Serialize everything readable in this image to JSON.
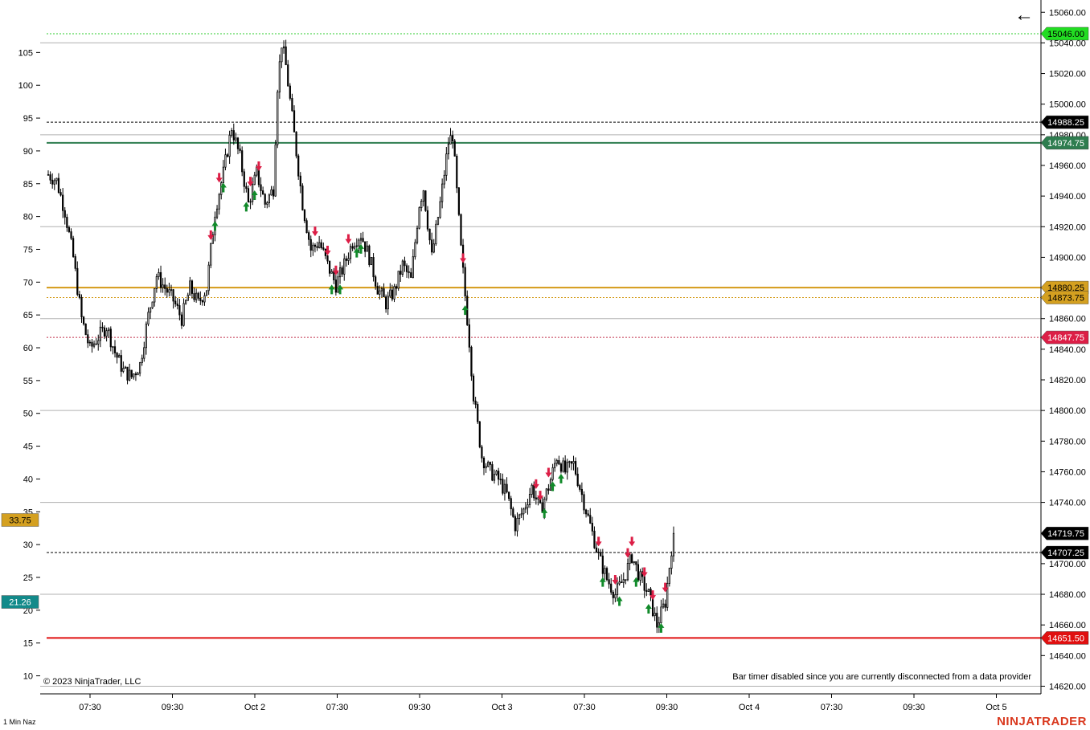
{
  "instrument_label": "1 Min Naz",
  "copyright": "© 2023 NinjaTrader, LLC",
  "bar_timer_message": "Bar timer disabled since you are currently disconnected from a data provider",
  "brand": "NINJATRADER",
  "back_icon": "arrow-left-icon",
  "chart_data": {
    "type": "candlestick",
    "price_axis": {
      "side": "right",
      "ylim": [
        14615,
        15068
      ],
      "ticks": [
        15060,
        15040,
        15020,
        15000,
        14980,
        14960,
        14940,
        14920,
        14900,
        14880,
        14860,
        14840,
        14820,
        14800,
        14780,
        14760,
        14740,
        14720,
        14700,
        14680,
        14660,
        14640,
        14620
      ],
      "tick_labels": [
        "15060.00",
        "15040.00",
        "15020.00",
        "15000.00",
        "14980.00",
        "14960.00",
        "14940.00",
        "14920.00",
        "14900.00",
        "14880.00",
        "14860.00",
        "14840.00",
        "14820.00",
        "14800.00",
        "14780.00",
        "14760.00",
        "14740.00",
        "14720.00",
        "14700.00",
        "14680.00",
        "14660.00",
        "14640.00",
        "14620.00"
      ]
    },
    "indicator_axis": {
      "side": "left",
      "ylim": [
        7.25,
        113
      ],
      "ticks": [
        105,
        100,
        95,
        90,
        85,
        80,
        75,
        70,
        65,
        60,
        55,
        50,
        45,
        40,
        35,
        30,
        25,
        20,
        15,
        10
      ],
      "tick_labels": [
        "105",
        "100",
        "95",
        "90",
        "85",
        "80",
        "75",
        "70",
        "65",
        "60",
        "55",
        "50",
        "45",
        "40",
        "35",
        "30",
        "25",
        "20",
        "15",
        "10"
      ],
      "value_tags": [
        {
          "label": "33.75",
          "value": 33.75,
          "color": "#d4a020"
        },
        {
          "label": "21.26",
          "value": 21.26,
          "color": "#128a8a"
        }
      ]
    },
    "time_axis": {
      "tick_labels": [
        "07:30",
        "09:30",
        "Oct 2",
        "07:30",
        "09:30",
        "Oct 3",
        "07:30",
        "09:30",
        "Oct 4",
        "07:30",
        "09:30",
        "Oct 5"
      ]
    },
    "horizontal_lines": [
      {
        "price": 15046.0,
        "label": "15046.00",
        "color": "#2ecc2e",
        "tag_bg": "#22dd22",
        "tag_fg": "#000000",
        "style": "dotted",
        "width": 1
      },
      {
        "price": 14988.25,
        "label": "14988.25",
        "color": "#000000",
        "tag_bg": "#000000",
        "tag_fg": "#ffffff",
        "style": "dashed",
        "width": 1
      },
      {
        "price": 14974.75,
        "label": "14974.75",
        "color": "#2e7d4f",
        "tag_bg": "#2e7d4f",
        "tag_fg": "#ffffff",
        "style": "solid",
        "width": 2
      },
      {
        "price": 14880.25,
        "label": "14880.25",
        "color": "#d49a16",
        "tag_bg": "#d4a020",
        "tag_fg": "#000000",
        "style": "solid",
        "width": 2
      },
      {
        "price": 14873.75,
        "label": "14873.75",
        "color": "#d49a16",
        "tag_bg": "#d4a020",
        "tag_fg": "#000000",
        "style": "dotted",
        "width": 1
      },
      {
        "price": 14847.75,
        "label": "14847.75",
        "color": "#c0304a",
        "tag_bg": "#dc1e46",
        "tag_fg": "#ffffff",
        "style": "dotted",
        "width": 1
      },
      {
        "price": 14707.25,
        "label": "14707.25",
        "color": "#000000",
        "tag_bg": "#000000",
        "tag_fg": "#ffffff",
        "style": "dashed",
        "width": 1
      },
      {
        "price": 14651.5,
        "label": "14651.50",
        "color": "#e01010",
        "tag_bg": "#e01010",
        "tag_fg": "#ffffff",
        "style": "solid",
        "width": 2
      }
    ],
    "last_price_tag": {
      "price": 14719.75,
      "label": "14719.75",
      "tag_bg": "#000000",
      "tag_fg": "#ffffff"
    },
    "grid_lines_price": [
      15040,
      14980,
      14920,
      14860,
      14800,
      14740,
      14680,
      14620
    ],
    "close_path": [
      [
        0,
        14954
      ],
      [
        4,
        14950
      ],
      [
        8,
        14930
      ],
      [
        12,
        14900
      ],
      [
        16,
        14860
      ],
      [
        20,
        14840
      ],
      [
        24,
        14848
      ],
      [
        28,
        14855
      ],
      [
        32,
        14838
      ],
      [
        36,
        14826
      ],
      [
        40,
        14822
      ],
      [
        44,
        14830
      ],
      [
        48,
        14862
      ],
      [
        52,
        14888
      ],
      [
        56,
        14880
      ],
      [
        60,
        14872
      ],
      [
        64,
        14860
      ],
      [
        68,
        14880
      ],
      [
        72,
        14870
      ],
      [
        76,
        14880
      ],
      [
        80,
        14930
      ],
      [
        84,
        14955
      ],
      [
        88,
        14985
      ],
      [
        92,
        14965
      ],
      [
        96,
        14935
      ],
      [
        100,
        14955
      ],
      [
        104,
        14935
      ],
      [
        108,
        14945
      ],
      [
        110,
        15012
      ],
      [
        112,
        15040
      ],
      [
        114,
        15025
      ],
      [
        118,
        14980
      ],
      [
        122,
        14935
      ],
      [
        126,
        14905
      ],
      [
        130,
        14910
      ],
      [
        134,
        14895
      ],
      [
        138,
        14882
      ],
      [
        142,
        14895
      ],
      [
        146,
        14910
      ],
      [
        150,
        14915
      ],
      [
        154,
        14900
      ],
      [
        158,
        14880
      ],
      [
        162,
        14870
      ],
      [
        166,
        14878
      ],
      [
        170,
        14895
      ],
      [
        174,
        14885
      ],
      [
        178,
        14935
      ],
      [
        180,
        14945
      ],
      [
        184,
        14900
      ],
      [
        188,
        14935
      ],
      [
        192,
        14975
      ],
      [
        194,
        14980
      ],
      [
        198,
        14905
      ],
      [
        202,
        14845
      ],
      [
        204,
        14810
      ],
      [
        208,
        14770
      ],
      [
        212,
        14760
      ],
      [
        216,
        14755
      ],
      [
        220,
        14745
      ],
      [
        224,
        14725
      ],
      [
        228,
        14735
      ],
      [
        232,
        14750
      ],
      [
        236,
        14735
      ],
      [
        240,
        14750
      ],
      [
        244,
        14770
      ],
      [
        248,
        14760
      ],
      [
        252,
        14765
      ],
      [
        256,
        14745
      ],
      [
        260,
        14725
      ],
      [
        264,
        14705
      ],
      [
        268,
        14690
      ],
      [
        272,
        14680
      ],
      [
        276,
        14690
      ],
      [
        280,
        14705
      ],
      [
        284,
        14690
      ],
      [
        288,
        14680
      ],
      [
        292,
        14660
      ],
      [
        296,
        14675
      ],
      [
        299,
        14710
      ],
      [
        300,
        14719.75
      ]
    ]
  }
}
